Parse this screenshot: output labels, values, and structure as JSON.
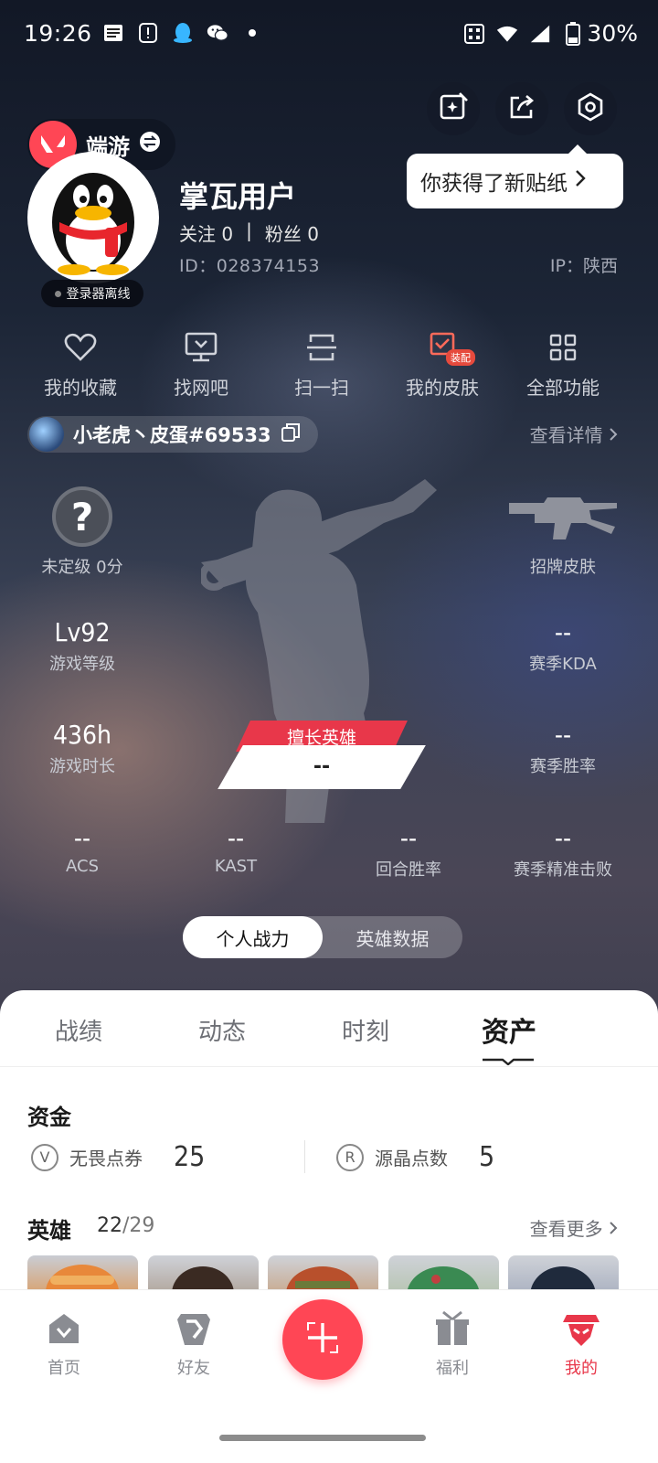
{
  "status_bar": {
    "time": "19:26",
    "battery": "30%",
    "left_icons": [
      "notes-icon",
      "alert-icon",
      "qq-icon",
      "wechat-icon",
      "dot-icon"
    ],
    "right_icons": [
      "nfc-icon",
      "wifi-icon",
      "signal-icon",
      "battery-icon"
    ]
  },
  "header": {
    "game_name": "端游",
    "tooltip": "你获得了新贴纸",
    "top_buttons": [
      "sticker-icon",
      "share-icon",
      "settings-hex-icon"
    ]
  },
  "profile": {
    "username": "掌瓦用户",
    "follow_label": "关注",
    "follow_count": "0",
    "separator": "|",
    "fans_label": "粉丝",
    "fans_count": "0",
    "id_label": "ID：",
    "id_value": "028374153",
    "ip_label": "IP：",
    "ip_value": "陕西",
    "status_badge": "登录器离线"
  },
  "features": [
    {
      "label": "我的收藏",
      "icon": "heart-icon"
    },
    {
      "label": "找网吧",
      "icon": "monitor-icon"
    },
    {
      "label": "扫一扫",
      "icon": "scan-icon"
    },
    {
      "label": "我的皮肤",
      "icon": "skin-icon",
      "badge": "装配"
    },
    {
      "label": "全部功能",
      "icon": "grid-icon"
    }
  ],
  "riot": {
    "name": "小老虎丶皮蛋#69533",
    "view_detail": "查看详情"
  },
  "stats": {
    "rank": {
      "label": "未定级 0分"
    },
    "signature_skin": {
      "label": "招牌皮肤"
    },
    "level": {
      "value": "Lv92",
      "label": "游戏等级"
    },
    "kda": {
      "value": "--",
      "label": "赛季KDA"
    },
    "playtime": {
      "value": "436h",
      "label": "游戏时长"
    },
    "winrate": {
      "value": "--",
      "label": "赛季胜率"
    },
    "main_hero": {
      "title": "擅长英雄",
      "value": "--"
    },
    "bottom_row": [
      {
        "value": "--",
        "label": "ACS"
      },
      {
        "value": "--",
        "label": "KAST"
      },
      {
        "value": "--",
        "label": "回合胜率"
      },
      {
        "value": "--",
        "label": "赛季精准击败"
      }
    ]
  },
  "toggle": {
    "active": "个人战力",
    "inactive": "英雄数据"
  },
  "tabs": [
    "战绩",
    "动态",
    "时刻",
    "资产"
  ],
  "active_tab": "资产",
  "funds": {
    "title": "资金",
    "items": [
      {
        "label": "无畏点券",
        "value": "25",
        "icon": "vp-coin-icon",
        "glyph": "V"
      },
      {
        "label": "源晶点数",
        "value": "5",
        "icon": "radianite-coin-icon",
        "glyph": "R"
      }
    ]
  },
  "heroes": {
    "title": "英雄",
    "owned": "22",
    "slash": "/",
    "total": "29",
    "see_more": "查看更多"
  },
  "bottom_nav": [
    {
      "label": "首页",
      "icon": "home-icon"
    },
    {
      "label": "好友",
      "icon": "friends-icon"
    },
    {
      "label": "",
      "icon": "plus-icon"
    },
    {
      "label": "福利",
      "icon": "gift-icon"
    },
    {
      "label": "我的",
      "icon": "me-icon"
    }
  ],
  "colors": {
    "accent": "#ff4655",
    "active_nav": "#e8374a"
  }
}
